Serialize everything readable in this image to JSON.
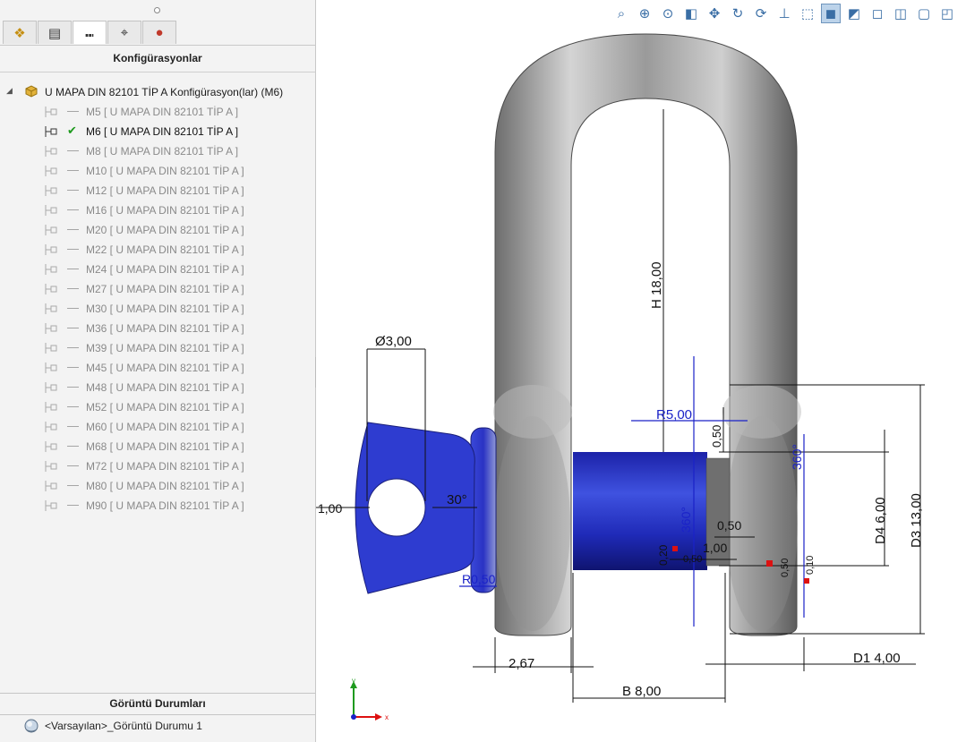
{
  "left_panel": {
    "tabs": [
      {
        "name": "feature-manager-tab",
        "icon": "part-feature-icon",
        "glyph": "❖"
      },
      {
        "name": "property-manager-tab",
        "icon": "property-list-icon",
        "glyph": "▤"
      },
      {
        "name": "configuration-manager-tab",
        "icon": "configuration-icon",
        "glyph": "⑉"
      },
      {
        "name": "dimxpert-manager-tab",
        "icon": "crosshair-icon",
        "glyph": "⌖"
      },
      {
        "name": "display-manager-tab",
        "icon": "appearance-ball-icon",
        "glyph": "●"
      }
    ],
    "title": "Konfigürasyonlar",
    "root": {
      "label": "U MAPA DIN 82101 TİP A Konfigürasyon(lar)  (M6)"
    },
    "items": [
      {
        "label": "M5 [ U MAPA DIN 82101 TİP A ]",
        "active": false
      },
      {
        "label": "M6 [ U MAPA DIN 82101 TİP A ]",
        "active": true
      },
      {
        "label": "M8 [ U MAPA DIN 82101 TİP A ]",
        "active": false
      },
      {
        "label": "M10 [ U MAPA DIN 82101 TİP A ]",
        "active": false
      },
      {
        "label": "M12 [ U MAPA DIN 82101 TİP A ]",
        "active": false
      },
      {
        "label": "M16 [ U MAPA DIN 82101 TİP A ]",
        "active": false
      },
      {
        "label": "M20 [ U MAPA DIN 82101 TİP A ]",
        "active": false
      },
      {
        "label": "M22 [ U MAPA DIN 82101 TİP A ]",
        "active": false
      },
      {
        "label": "M24 [ U MAPA DIN 82101 TİP A ]",
        "active": false
      },
      {
        "label": "M27 [ U MAPA DIN 82101 TİP A ]",
        "active": false
      },
      {
        "label": "M30 [ U MAPA DIN 82101 TİP A ]",
        "active": false
      },
      {
        "label": "M36 [ U MAPA DIN 82101 TİP A ]",
        "active": false
      },
      {
        "label": "M39 [ U MAPA DIN 82101 TİP A ]",
        "active": false
      },
      {
        "label": "M45 [ U MAPA DIN 82101 TİP A ]",
        "active": false
      },
      {
        "label": "M48 [ U MAPA DIN 82101 TİP A ]",
        "active": false
      },
      {
        "label": "M52 [ U MAPA DIN 82101 TİP A ]",
        "active": false
      },
      {
        "label": "M60 [ U MAPA DIN 82101 TİP A ]",
        "active": false
      },
      {
        "label": "M68 [ U MAPA DIN 82101 TİP A ]",
        "active": false
      },
      {
        "label": "M72 [ U MAPA DIN 82101 TİP A ]",
        "active": false
      },
      {
        "label": "M80 [ U MAPA DIN 82101 TİP A ]",
        "active": false
      },
      {
        "label": "M90 [ U MAPA DIN 82101 TİP A ]",
        "active": false
      }
    ],
    "display_states_title": "Görüntü Durumları",
    "display_state": "<Varsayılan>_Görüntü Durumu 1"
  },
  "view_toolbar": [
    {
      "icon": "zoom-to-fit-icon",
      "glyph": "⌕"
    },
    {
      "icon": "zoom-to-area-icon",
      "glyph": "⊕"
    },
    {
      "icon": "zoom-selection-icon",
      "glyph": "⊙"
    },
    {
      "icon": "section-view-icon",
      "glyph": "◧"
    },
    {
      "icon": "pan-icon",
      "glyph": "✥"
    },
    {
      "icon": "rotate-view-icon",
      "glyph": "↻"
    },
    {
      "icon": "rotate-3d-icon",
      "glyph": "⟳"
    },
    {
      "icon": "normal-to-icon",
      "glyph": "⊥"
    },
    {
      "icon": "apply-scene-icon",
      "glyph": "⬚"
    },
    {
      "icon": "shaded-with-edges-icon",
      "glyph": "◼"
    },
    {
      "icon": "shaded-icon",
      "glyph": "◩"
    },
    {
      "icon": "hidden-lines-removed-icon",
      "glyph": "◻"
    },
    {
      "icon": "hidden-lines-visible-icon",
      "glyph": "◫"
    },
    {
      "icon": "wireframe-icon",
      "glyph": "▢"
    },
    {
      "icon": "view-orientation-icon",
      "glyph": "◰"
    }
  ],
  "dimensions": {
    "height": "H  18,00",
    "pin_diameter": "Ø3,00",
    "radius_top": "R5,00",
    "gap_top": "0,50",
    "angle_top": "360°",
    "d4": "D4  6,00",
    "d3": "D3  13,00",
    "angle_mid": "360°",
    "gap_mid": "0,50",
    "len_mid": "1,00",
    "small_a": "0,20",
    "small_b": "0,50",
    "small_c": "0,50",
    "small_d": "0,10",
    "left_one": "1,00",
    "angle_30": "30°",
    "radius_small": "R0,50",
    "thickness": "2,67",
    "b": "B  8,00",
    "d1": "D1  4,00"
  },
  "triad": {
    "x": "x",
    "y": "y"
  }
}
